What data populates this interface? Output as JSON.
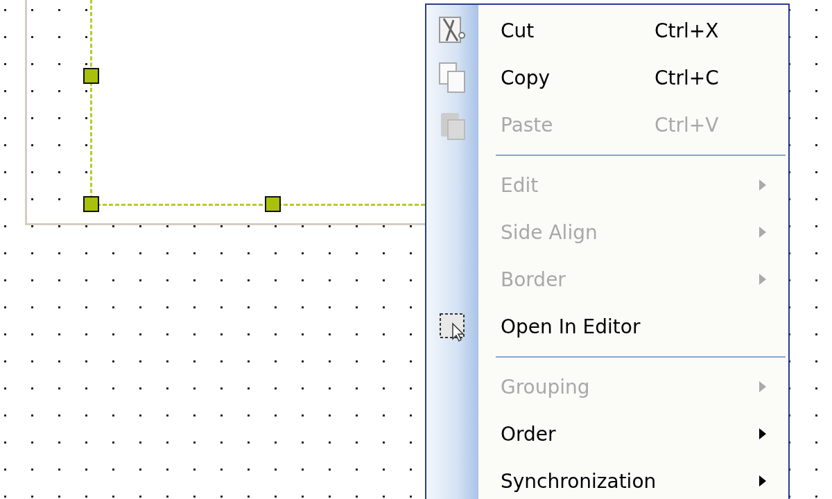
{
  "context_menu": {
    "items": [
      {
        "kind": "command",
        "label": "Cut",
        "shortcut": "Ctrl+X",
        "disabled": false,
        "submenu": false
      },
      {
        "kind": "command",
        "label": "Copy",
        "shortcut": "Ctrl+C",
        "disabled": false,
        "submenu": false
      },
      {
        "kind": "command",
        "label": "Paste",
        "shortcut": "Ctrl+V",
        "disabled": true,
        "submenu": false
      },
      {
        "kind": "separator"
      },
      {
        "kind": "command",
        "label": "Edit",
        "disabled": true,
        "submenu": true
      },
      {
        "kind": "command",
        "label": "Side Align",
        "disabled": true,
        "submenu": true
      },
      {
        "kind": "command",
        "label": "Border",
        "disabled": true,
        "submenu": true
      },
      {
        "kind": "command",
        "label": "Open In Editor",
        "disabled": false,
        "submenu": false
      },
      {
        "kind": "separator"
      },
      {
        "kind": "command",
        "label": "Grouping",
        "disabled": true,
        "submenu": true
      },
      {
        "kind": "command",
        "label": "Order",
        "disabled": false,
        "submenu": true
      },
      {
        "kind": "command",
        "label": "Synchronization",
        "disabled": false,
        "submenu": true
      }
    ]
  }
}
